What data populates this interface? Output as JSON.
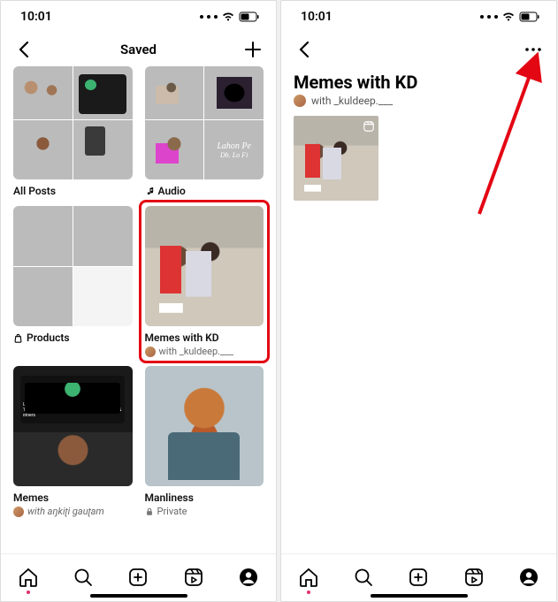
{
  "status": {
    "time": "10:01"
  },
  "screen1": {
    "title": "Saved",
    "collections": [
      {
        "label": "All Posts"
      },
      {
        "label": "Audio",
        "icon": "music",
        "cover_text_top": "Lahon Pe",
        "cover_text_sub": "Dh. Lo Fi"
      },
      {
        "label": "Products",
        "icon": "bag"
      },
      {
        "label": "Memes with KD",
        "with": "with _kuldeep.___",
        "highlighted": true
      },
      {
        "label": "Memes",
        "with": "with aŋkiʈi gauʈam",
        "banner": "UPI transactions of over ₹2,000 to be charged at 1.1% starting 1st April for Gpay, Paytm, PhonePe & others"
      },
      {
        "label": "Manliness",
        "privacy": "Private",
        "icon": "lock"
      }
    ]
  },
  "screen2": {
    "title": "Memes with KD",
    "with": "with _kuldeep.___"
  },
  "tabs": [
    "home",
    "search",
    "create",
    "reels",
    "profile"
  ]
}
